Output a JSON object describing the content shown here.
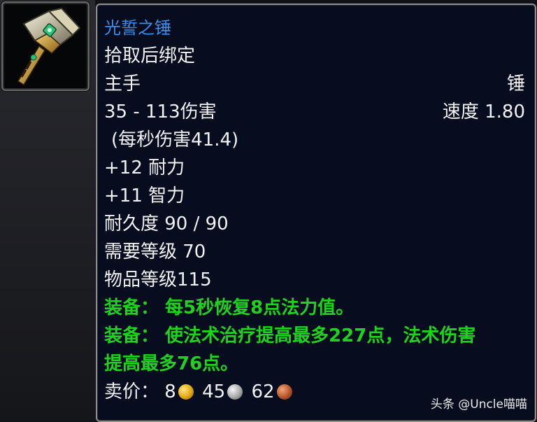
{
  "item": {
    "name": "光誓之锤",
    "binding": "拾取后绑定",
    "slot": "主手",
    "type": "锤",
    "damage": "35 - 113伤害",
    "speed": "速度 1.80",
    "dps": "(每秒伤害41.4)",
    "stats": [
      "+12 耐力",
      "+11 智力"
    ],
    "durability": "耐久度 90 / 90",
    "required_level": "需要等级 70",
    "item_level": "物品等级115",
    "equip_effects": [
      "装备： 每5秒恢复8点法力值。",
      "装备： 使法术治疗提高最多227点，法术伤害",
      "提高最多76点。"
    ],
    "sell_price": {
      "label": "卖价：",
      "gold": "8",
      "silver": "45",
      "copper": "62"
    }
  },
  "icon": "hammer-icon",
  "watermark": "头条 @Uncle喵喵",
  "colors": {
    "name": "#3b8eea",
    "effect": "#1ed21e",
    "text": "#f2f2f2"
  }
}
